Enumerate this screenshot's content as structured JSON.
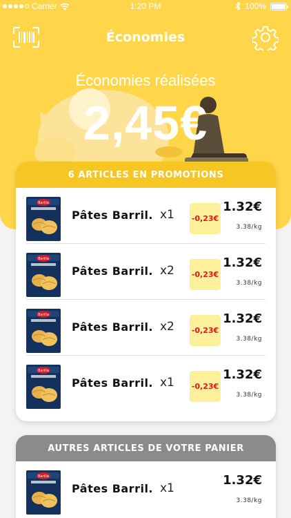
{
  "status_bar": {
    "carrier": "Carrier",
    "time": "1:20 PM",
    "battery": "100%"
  },
  "header": {
    "title": "Économies"
  },
  "summary": {
    "label": "Économies réalisées",
    "amount": "2,45€"
  },
  "promotions": {
    "title": "6 ARTICLES EN PROMOTIONS",
    "items": [
      {
        "name": "Pâtes Barril.",
        "qty": "x1",
        "discount": "-0,23€",
        "price": "1.32€",
        "unit_price": "3.38/kg"
      },
      {
        "name": "Pâtes Barril.",
        "qty": "x2",
        "discount": "-0,23€",
        "price": "1.32€",
        "unit_price": "3.38/kg"
      },
      {
        "name": "Pâtes Barril.",
        "qty": "x2",
        "discount": "-0,23€",
        "price": "1.32€",
        "unit_price": "3.38/kg"
      },
      {
        "name": "Pâtes Barril.",
        "qty": "x1",
        "discount": "-0,23€",
        "price": "1.32€",
        "unit_price": "3.38/kg"
      }
    ]
  },
  "others": {
    "title": "AUTRES ARTICLES DE VOTRE PANIER",
    "items": [
      {
        "name": "Pâtes Barril.",
        "qty": "x1",
        "price": "1.32€",
        "unit_price": "3.38/kg"
      }
    ]
  },
  "icons": {
    "left": "barcode-scanner-icon",
    "right": "gear-icon"
  },
  "colors": {
    "hero": "#ffd54a",
    "promo_header": "#f6c624",
    "others_header": "#8b8b8b",
    "discount_text": "#e01818",
    "discount_bg": "#fdf09a"
  }
}
